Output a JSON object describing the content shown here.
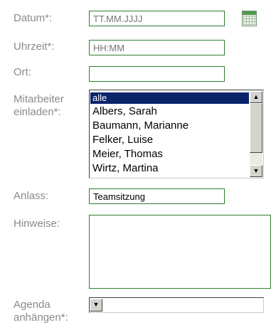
{
  "form": {
    "datum": {
      "label": "Datum*:",
      "placeholder": "TT.MM.JJJJ",
      "value": ""
    },
    "uhrzeit": {
      "label": "Uhrzeit*:",
      "placeholder": "HH:MM",
      "value": ""
    },
    "ort": {
      "label": "Ort:",
      "value": ""
    },
    "mitarbeiter": {
      "label": "Mitarbeiter\neinladen*:",
      "options": [
        "alle",
        "Albers, Sarah",
        "Baumann, Marianne",
        "Felker, Luise",
        "Meier, Thomas",
        "Wirtz, Martina"
      ],
      "selected": "alle"
    },
    "anlass": {
      "label": "Anlass:",
      "value": "Teamsitzung"
    },
    "hinweise": {
      "label": "Hinweise:",
      "value": ""
    },
    "agenda": {
      "label": "Agenda\nanhängen*:",
      "value": "---"
    }
  },
  "icons": {
    "calendar": "calendar-icon",
    "scroll_up": "▲",
    "scroll_down": "▼",
    "dropdown": "▼"
  },
  "colors": {
    "field_border": "#2f7d2f",
    "label_text": "#8a8a8a",
    "selection_bg": "#0a246a"
  }
}
